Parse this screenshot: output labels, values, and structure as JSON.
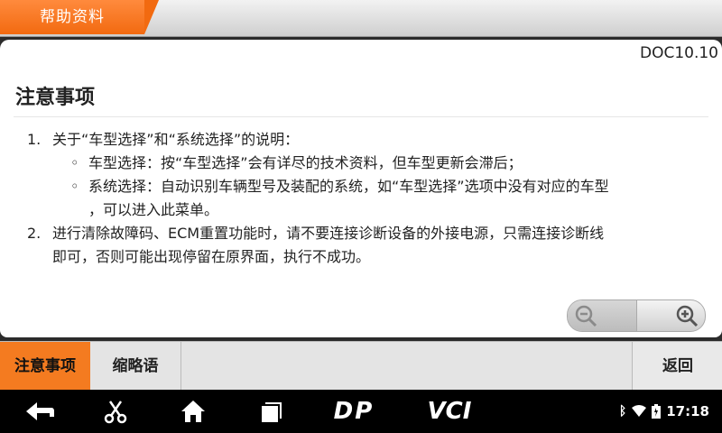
{
  "header": {
    "title": "帮助资料"
  },
  "document": {
    "code": "DOC10.10",
    "heading": "注意事项",
    "items": [
      {
        "num": "1.",
        "text": "关于“车型选择”和“系统选择”的说明："
      },
      {
        "bullet": "◦",
        "text": "车型选择：按“车型选择”会有详尽的技术资料，但车型更新会滞后；"
      },
      {
        "bullet": "◦",
        "text": "系统选择：自动识别车辆型号及装配的系统，如“车型选择”选项中没有对应的车型"
      },
      {
        "text": "，可以进入此菜单。"
      },
      {
        "num": "2.",
        "text": "进行清除故障码、ECM重置功能时，请不要连接诊断设备的外接电源，只需连接诊断线"
      },
      {
        "text": "即可，否则可能出现停留在原界面，执行不成功。"
      }
    ]
  },
  "tabs": {
    "active": "注意事项",
    "second": "缩略语",
    "back": "返回"
  },
  "navbar": {
    "dp_label": "DP",
    "vci_label": "VCI",
    "time": "17:18"
  },
  "colors": {
    "accent": "#f47b20"
  }
}
